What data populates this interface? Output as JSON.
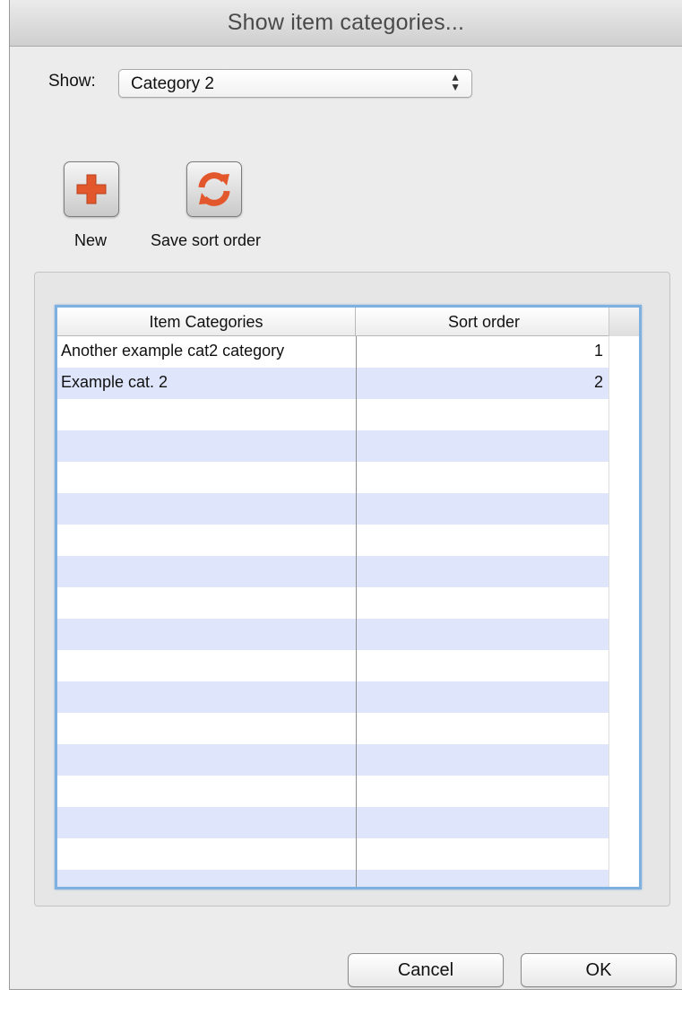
{
  "window": {
    "title": "Show item categories..."
  },
  "show": {
    "label": "Show:",
    "selected": "Category 2"
  },
  "toolbar": {
    "new": {
      "label": "New",
      "icon": "plus-icon",
      "color": "#e3572d"
    },
    "save_sort": {
      "label": "Save sort order",
      "icon": "refresh-icon",
      "color": "#e3572d"
    }
  },
  "table": {
    "columns": [
      "Item Categories",
      "Sort order"
    ],
    "rows": [
      {
        "name": "Another example cat2 category",
        "sort": "1"
      },
      {
        "name": "Example cat. 2",
        "sort": "2"
      }
    ],
    "stripe_color": "#dfe6fb"
  },
  "buttons": {
    "cancel": "Cancel",
    "ok": "OK"
  }
}
